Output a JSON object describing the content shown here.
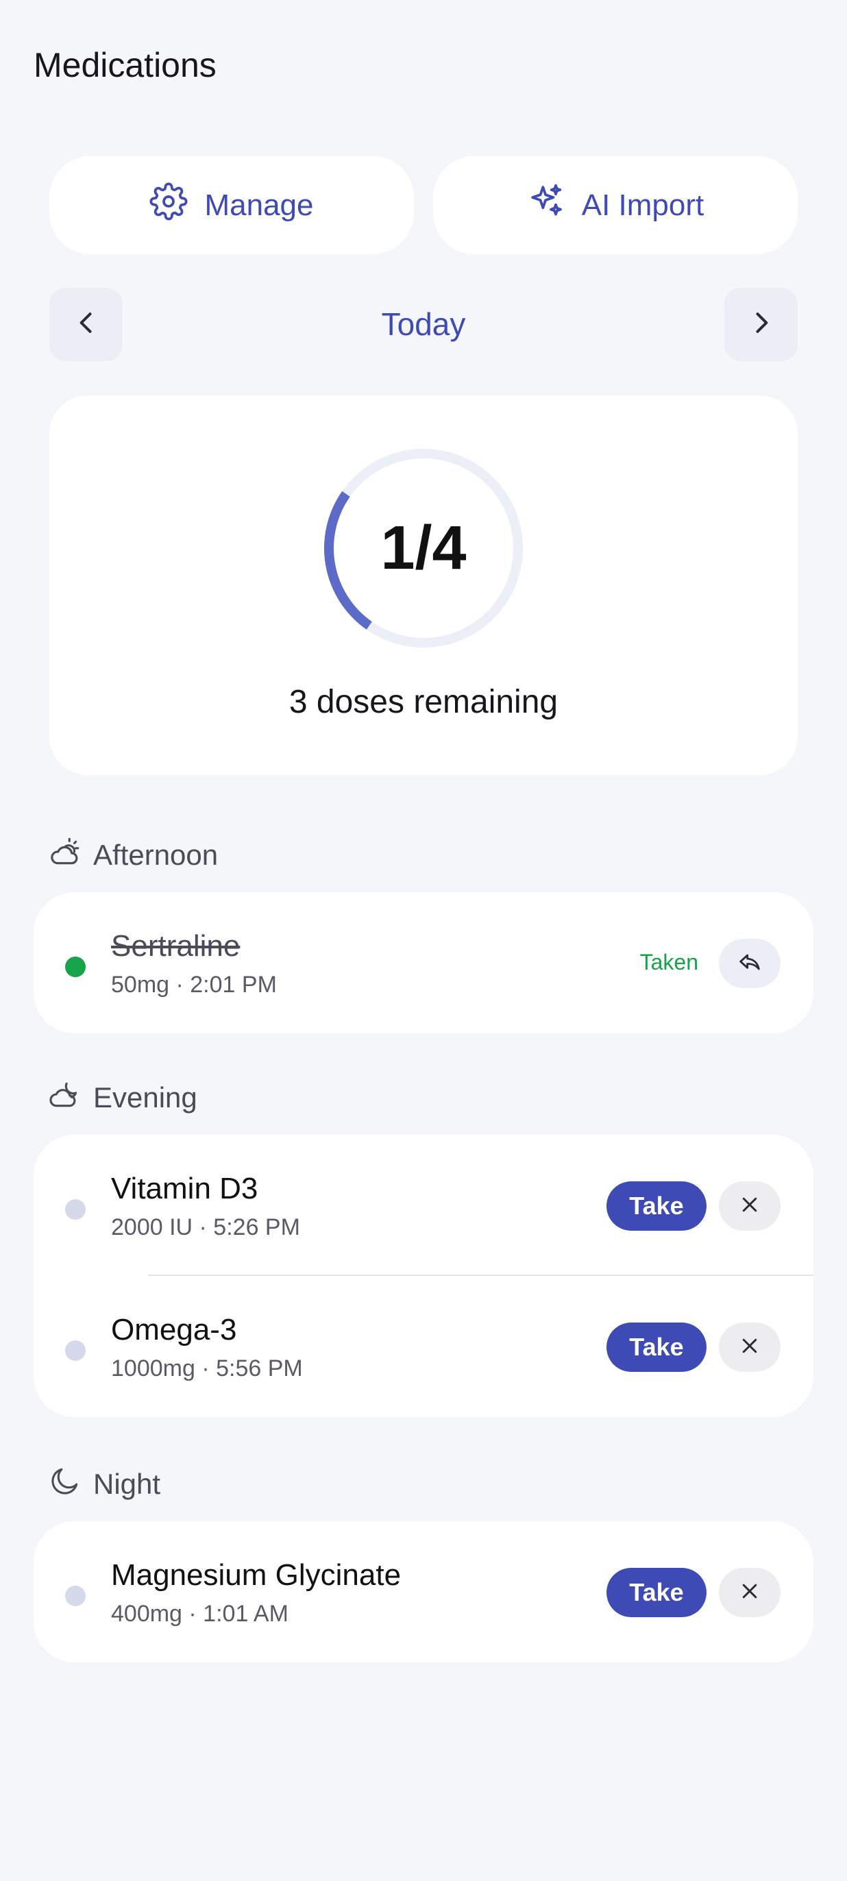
{
  "header": {
    "title": "Medications"
  },
  "actions": {
    "manage_label": "Manage",
    "import_label": "AI Import"
  },
  "date_nav": {
    "label": "Today"
  },
  "progress": {
    "taken": 1,
    "total": 4,
    "display": "1/4",
    "remaining_text": "3 doses remaining",
    "ring_color": "#5c6bc7",
    "track_color": "#eceef8"
  },
  "sections": [
    {
      "name": "Afternoon",
      "icon": "cloud-sun-icon",
      "items": [
        {
          "name": "Sertraline",
          "meta": "50mg · 2:01 PM",
          "status": "taken",
          "status_label": "Taken"
        }
      ]
    },
    {
      "name": "Evening",
      "icon": "cloud-moon-icon",
      "items": [
        {
          "name": "Vitamin D3",
          "meta": "2000 IU · 5:26 PM",
          "status": "pending",
          "action_label": "Take"
        },
        {
          "name": "Omega-3",
          "meta": "1000mg · 5:56 PM",
          "status": "pending",
          "action_label": "Take"
        }
      ]
    },
    {
      "name": "Night",
      "icon": "moon-icon",
      "items": [
        {
          "name": "Magnesium Glycinate",
          "meta": "400mg · 1:01 AM",
          "status": "pending",
          "action_label": "Take"
        }
      ]
    }
  ],
  "colors": {
    "accent": "#3f4bb4",
    "taken_green": "#16a34a",
    "pending_dot": "#d6d9ea",
    "background": "#f5f6fa"
  }
}
